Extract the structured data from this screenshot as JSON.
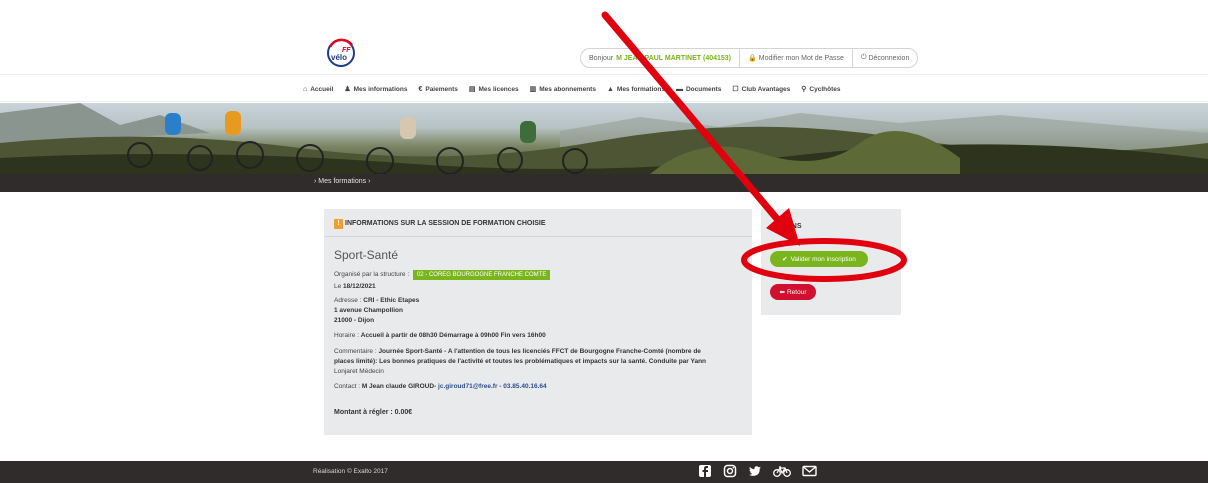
{
  "header": {
    "logo_text": "FF vélo",
    "greeting": "Bonjour",
    "user_name": "M JEAN PAUL MARTINET (404153)",
    "change_password": "Modifier mon Mot de Passe",
    "logout": "Déconnexion"
  },
  "nav": {
    "items": [
      {
        "label": "Accueil",
        "icon": "home-icon"
      },
      {
        "label": "Mes informations",
        "icon": "user-icon"
      },
      {
        "label": "Paiements",
        "icon": "euro-icon"
      },
      {
        "label": "Mes licences",
        "icon": "card-icon"
      },
      {
        "label": "Mes abonnements",
        "icon": "book-icon"
      },
      {
        "label": "Mes formations",
        "icon": "graduation-cap-icon"
      },
      {
        "label": "Documents",
        "icon": "folder-icon"
      },
      {
        "label": "Club Avantages",
        "icon": "square-icon"
      },
      {
        "label": "Cyclhôtes",
        "icon": "search-icon"
      }
    ]
  },
  "breadcrumb": "›  Mes formations  ›",
  "session": {
    "panel_title": "INFORMATIONS SUR LA SESSION DE FORMATION CHOISIE",
    "name": "Sport-Santé",
    "organizer_label": "Organisé par la structure :",
    "organizer": "02 - COREG BOURGOGNE FRANCHE COMTE",
    "date_label": "Le",
    "date": "18/12/2021",
    "address_label": "Adresse :",
    "address_1": "CRI - Ethic Etapes",
    "address_2": "1 avenue Champollion",
    "address_3": "21000 - Dijon",
    "hours_label": "Horaire :",
    "hours": "Accueil à partir de 08h30 Démarrage à 09h00 Fin vers 16h00",
    "comment_label": "Commentaire :",
    "comment_1": "Journée Sport-Santé - A l'attention de tous les licenciés FFCT de Bourgogne Franche-Comté (nombre de",
    "comment_2": "places limité): Les bonnes pratiques de l'activité et toutes les problématiques et impacts sur la santé. Conduite par Yann",
    "comment_3": "Lonjaret Médecin",
    "contact_label": "Contact :",
    "contact_name": "M Jean claude GIROUD-",
    "contact_email": "jc.giroud71@free.fr",
    "contact_phone": "- 03.85.40.16.64",
    "amount": "Montant à régler : 0.00€"
  },
  "actions": {
    "title": "ACTIONS",
    "validate": "Valider mon inscription",
    "back": "Retour"
  },
  "footer": {
    "credit": "Réalisation © Exalto 2017",
    "social": [
      "facebook-icon",
      "instagram-icon",
      "twitter-icon",
      "bike-icon",
      "mail-icon"
    ]
  },
  "colors": {
    "accent_green": "#7ab51d",
    "accent_red": "#d0102e",
    "annotation_red": "#e0000e",
    "dark_bar": "#2f2c2b"
  }
}
